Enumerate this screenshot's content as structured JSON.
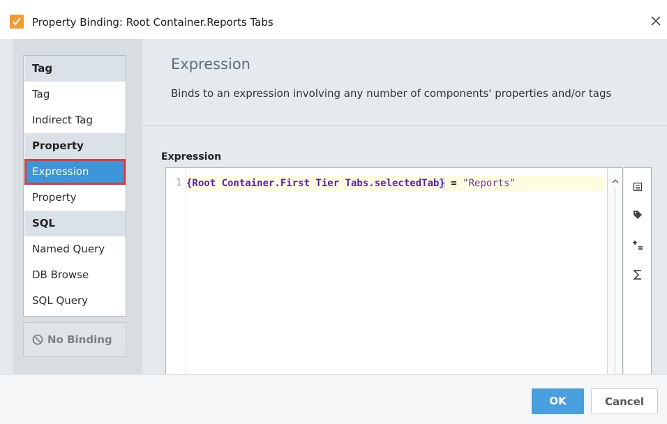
{
  "window": {
    "title": "Property Binding: Root Container.Reports Tabs",
    "icon": "property-binding-app-icon"
  },
  "sidebar": {
    "sections": [
      {
        "label": "Tag",
        "items": [
          "Tag",
          "Indirect Tag"
        ]
      },
      {
        "label": "Property",
        "items": [
          "Expression",
          "Property"
        ]
      },
      {
        "label": "SQL",
        "items": [
          "Named Query",
          "DB Browse",
          "SQL Query"
        ]
      }
    ],
    "selected": "Expression",
    "no_binding_label": "No Binding"
  },
  "panel": {
    "title": "Expression",
    "description": "Binds to an expression involving any number of components' properties and/or tags"
  },
  "editor": {
    "label": "Expression",
    "line_number": "1",
    "code_prop": "{Root Container.First Tier Tabs.selectedTab",
    "code_brace": "}",
    "code_op": " = ",
    "code_str": "\"Reports\""
  },
  "footer": {
    "ok_label": "OK",
    "cancel_label": "Cancel"
  },
  "colors": {
    "accent": "#3b95d8",
    "selection_outline": "#e53935",
    "app_icon": "#f39a31"
  }
}
